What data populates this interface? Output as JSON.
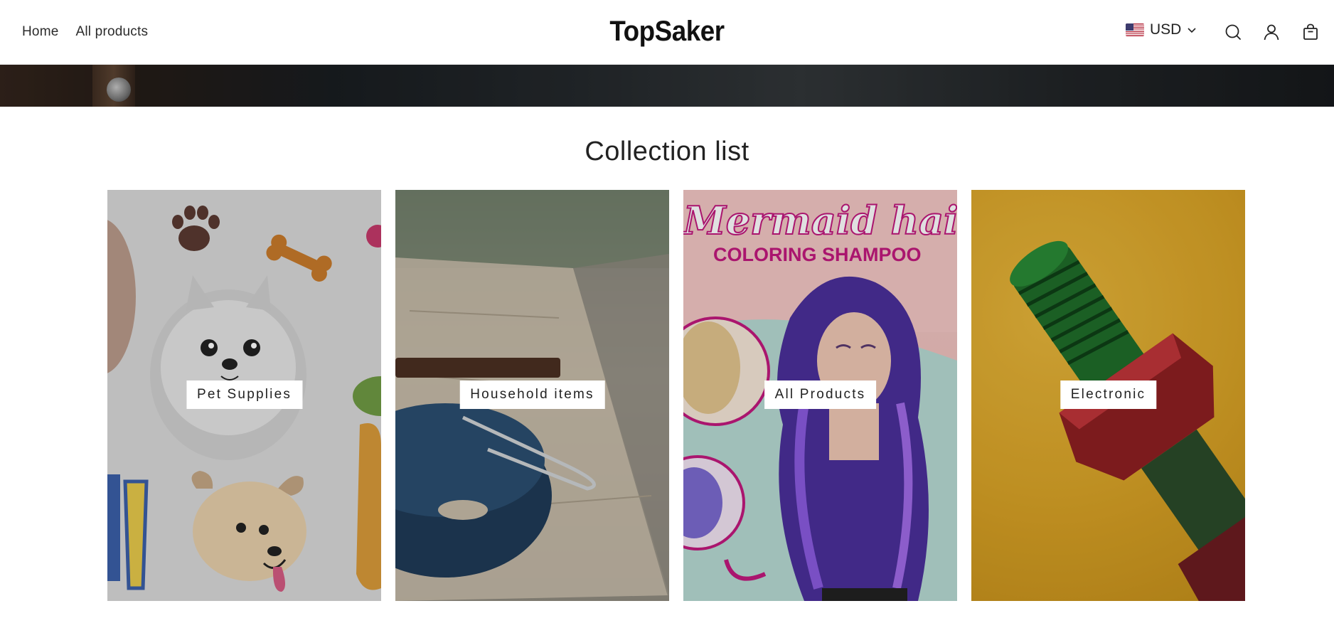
{
  "header": {
    "nav": [
      {
        "label": "Home"
      },
      {
        "label": "All products"
      }
    ],
    "logo": "TopSaker",
    "currency": {
      "code": "USD",
      "flag_icon": "us-flag-icon"
    },
    "icons": [
      "search-icon",
      "account-icon",
      "cart-icon"
    ]
  },
  "collection": {
    "title": "Collection list",
    "items": [
      {
        "label": "Pet Supplies",
        "image": "pet-cartoon-image"
      },
      {
        "label": "Household items",
        "image": "pan-on-table-image"
      },
      {
        "label": "All Products",
        "image": "mermaid-hair-woman-image"
      },
      {
        "label": "Electronic",
        "image": "bolt-nut-image"
      }
    ],
    "promo_text": {
      "line1": "Mermaid hair",
      "line2": "COLORING SHAMPOO"
    }
  },
  "colors": {
    "accent_magenta": "#c2187e",
    "bolt_green": "#1f8a2e",
    "bolt_red": "#b3262b",
    "yellow_bg": "#d8a226"
  }
}
